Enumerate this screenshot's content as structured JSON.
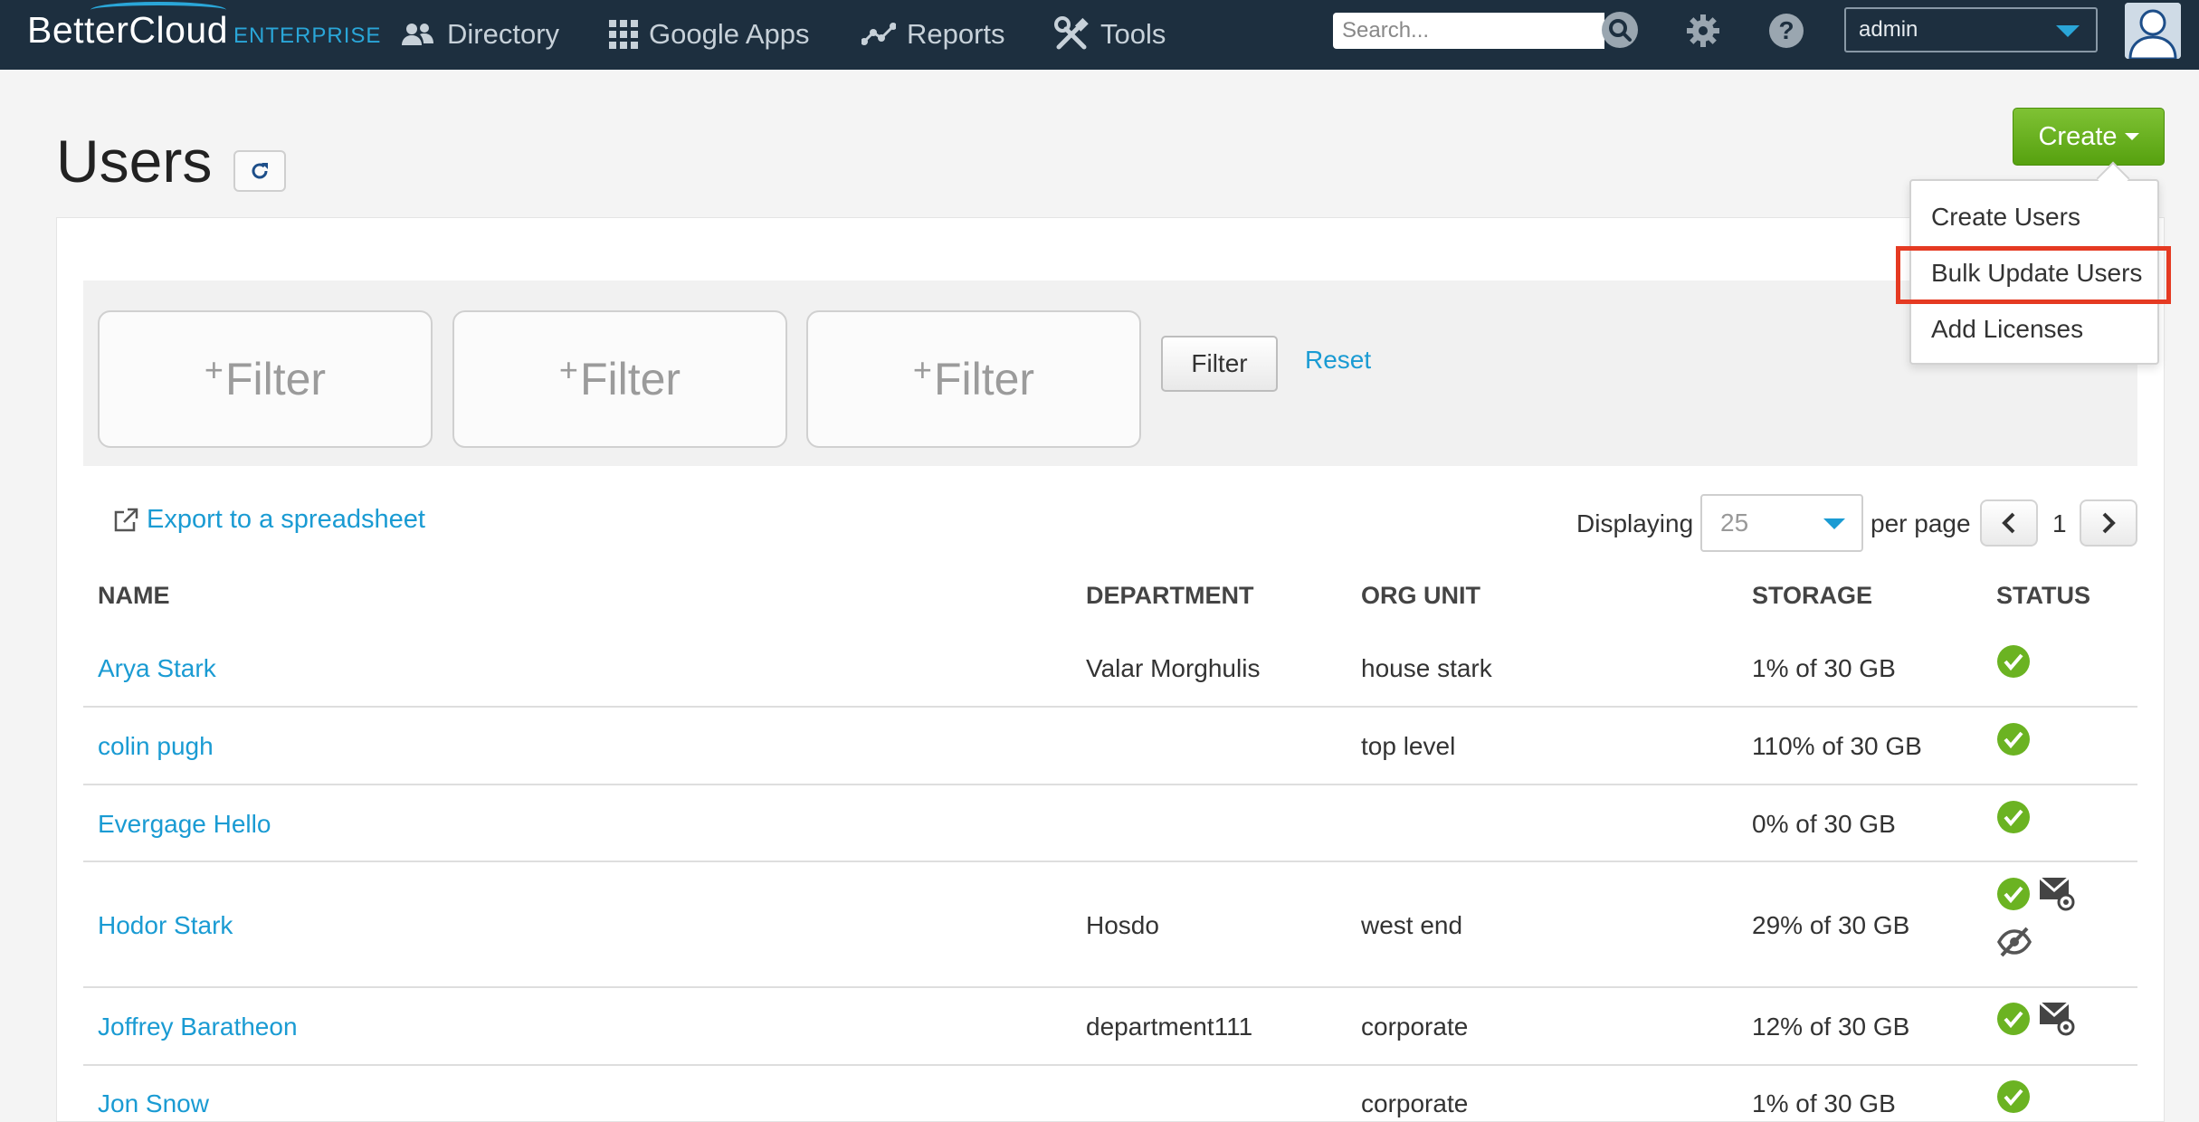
{
  "nav": {
    "brand": "BetterCloud",
    "brand_sub": "ENTERPRISE",
    "items": [
      {
        "label": "Directory",
        "icon": "users-icon"
      },
      {
        "label": "Google Apps",
        "icon": "grid-icon"
      },
      {
        "label": "Reports",
        "icon": "chart-icon"
      },
      {
        "label": "Tools",
        "icon": "tools-icon"
      }
    ],
    "search_placeholder": "Search...",
    "account": "admin"
  },
  "page": {
    "title": "Users",
    "create_label": "Create"
  },
  "create_menu": {
    "items": [
      "Create Users",
      "Bulk Update Users",
      "Add Licenses"
    ],
    "highlighted": "Bulk Update Users"
  },
  "filters": {
    "slots": [
      "Filter",
      "Filter",
      "Filter"
    ],
    "plus": "+",
    "filter_button": "Filter",
    "reset": "Reset"
  },
  "toolbar": {
    "export": "Export to a spreadsheet",
    "displaying": "Displaying",
    "per_page_value": "25",
    "per_page": "per page",
    "page": "1"
  },
  "table": {
    "headers": {
      "name": "NAME",
      "department": "DEPARTMENT",
      "org_unit": "ORG UNIT",
      "storage": "STORAGE",
      "status": "STATUS"
    },
    "rows": [
      {
        "name": "Arya Stark",
        "department": "Valar Morghulis",
        "org_unit": "house stark",
        "storage": "1% of 30 GB",
        "status": [
          "active"
        ]
      },
      {
        "name": "colin pugh",
        "department": "",
        "org_unit": "top level",
        "storage": "110% of 30 GB",
        "status": [
          "active"
        ]
      },
      {
        "name": "Evergage Hello",
        "department": "",
        "org_unit": "",
        "storage": "0% of 30 GB",
        "status": [
          "active"
        ]
      },
      {
        "name": "Hodor Stark",
        "department": "Hosdo",
        "org_unit": "west end",
        "storage": "29% of 30 GB",
        "status": [
          "active",
          "mail-forward",
          "hidden"
        ]
      },
      {
        "name": "Joffrey Baratheon",
        "department": "department111",
        "org_unit": "corporate",
        "storage": "12% of 30 GB",
        "status": [
          "active",
          "mail-forward"
        ]
      },
      {
        "name": "Jon Snow",
        "department": "",
        "org_unit": "corporate",
        "storage": "1% of 30 GB",
        "status": [
          "active"
        ]
      }
    ]
  },
  "colors": {
    "navbar": "#1d2f3f",
    "link": "#1a9bd3",
    "create": "#6bb322",
    "highlight": "#e53a22",
    "status_ok": "#6bb322"
  }
}
